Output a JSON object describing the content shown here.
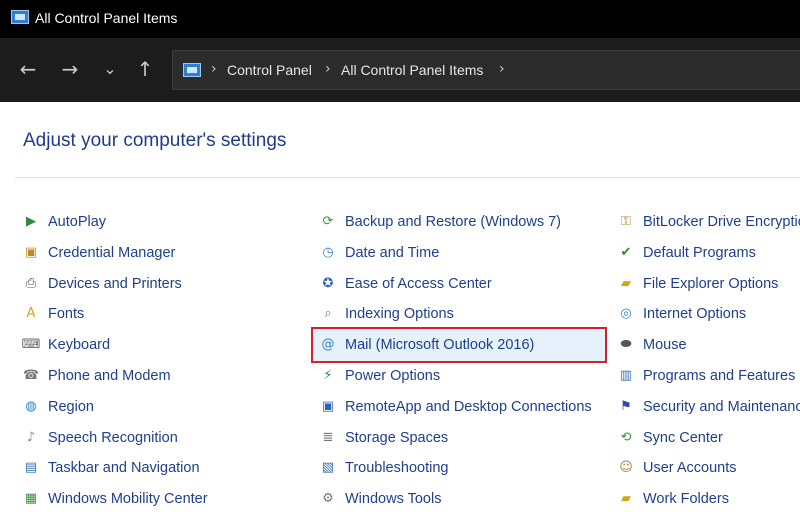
{
  "window": {
    "title": "All Control Panel Items",
    "icon": "control-panel-icon"
  },
  "nav": {
    "back": "←",
    "forward": "→",
    "recent": "⌄",
    "up": "↑"
  },
  "address": {
    "icon": "control-panel-icon",
    "separator": "›",
    "crumbs": [
      "Control Panel",
      "All Control Panel Items"
    ]
  },
  "heading": "Adjust your computer's settings",
  "columns": [
    {
      "items": [
        {
          "label": "AutoPlay",
          "icon": "autoplay-icon",
          "glyph": "▶",
          "color": "#2e8b3a"
        },
        {
          "label": "Credential Manager",
          "icon": "credential-icon",
          "glyph": "▣",
          "color": "#c08a2b"
        },
        {
          "label": "Devices and Printers",
          "icon": "printer-icon",
          "glyph": "⎙",
          "color": "#555555"
        },
        {
          "label": "Fonts",
          "icon": "fonts-icon",
          "glyph": "A",
          "color": "#d8a21c"
        },
        {
          "label": "Keyboard",
          "icon": "keyboard-icon",
          "glyph": "⌨",
          "color": "#666666"
        },
        {
          "label": "Phone and Modem",
          "icon": "phone-icon",
          "glyph": "☎",
          "color": "#777777"
        },
        {
          "label": "Region",
          "icon": "region-icon",
          "glyph": "◍",
          "color": "#2f7fc8"
        },
        {
          "label": "Speech Recognition",
          "icon": "microphone-icon",
          "glyph": "♪",
          "color": "#8a8a8a"
        },
        {
          "label": "Taskbar and Navigation",
          "icon": "taskbar-icon",
          "glyph": "▤",
          "color": "#3a6fb8"
        },
        {
          "label": "Windows Mobility Center",
          "icon": "mobility-icon",
          "glyph": "▦",
          "color": "#3c8d3c"
        }
      ]
    },
    {
      "items": [
        {
          "label": "Backup and Restore (Windows 7)",
          "icon": "backup-icon",
          "glyph": "⟳",
          "color": "#3a9a3a"
        },
        {
          "label": "Date and Time",
          "icon": "clock-icon",
          "glyph": "◷",
          "color": "#3b7cc5"
        },
        {
          "label": "Ease of Access Center",
          "icon": "accessibility-icon",
          "glyph": "✪",
          "color": "#2a64b8"
        },
        {
          "label": "Indexing Options",
          "icon": "indexing-icon",
          "glyph": "⌕",
          "color": "#777777"
        },
        {
          "label": "Mail (Microsoft Outlook 2016)",
          "icon": "mail-icon",
          "glyph": "@",
          "color": "#2f7fc8"
        },
        {
          "label": "Power Options",
          "icon": "power-icon",
          "glyph": "⚡",
          "color": "#2e8b3a"
        },
        {
          "label": "RemoteApp and Desktop Connections",
          "icon": "remoteapp-icon",
          "glyph": "▣",
          "color": "#2a64b8"
        },
        {
          "label": "Storage Spaces",
          "icon": "storage-icon",
          "glyph": "≣",
          "color": "#777777"
        },
        {
          "label": "Troubleshooting",
          "icon": "troubleshoot-icon",
          "glyph": "▧",
          "color": "#3b6fb3"
        },
        {
          "label": "Windows Tools",
          "icon": "tools-icon",
          "glyph": "⚙",
          "color": "#777777"
        }
      ]
    },
    {
      "items": [
        {
          "label": "BitLocker Drive Encryption",
          "icon": "bitlocker-icon",
          "glyph": "⚿",
          "color": "#b0862c"
        },
        {
          "label": "Default Programs",
          "icon": "default-programs-icon",
          "glyph": "✔",
          "color": "#2e8b3a"
        },
        {
          "label": "File Explorer Options",
          "icon": "folder-options-icon",
          "glyph": "▰",
          "color": "#d8a21c"
        },
        {
          "label": "Internet Options",
          "icon": "internet-icon",
          "glyph": "◎",
          "color": "#2f7fc8"
        },
        {
          "label": "Mouse",
          "icon": "mouse-icon",
          "glyph": "⬬",
          "color": "#555555"
        },
        {
          "label": "Programs and Features",
          "icon": "programs-icon",
          "glyph": "▥",
          "color": "#3b6fb3"
        },
        {
          "label": "Security and Maintenance",
          "icon": "flag-icon",
          "glyph": "⚑",
          "color": "#2a4fa8"
        },
        {
          "label": "Sync Center",
          "icon": "sync-icon",
          "glyph": "⟲",
          "color": "#2e9a3a"
        },
        {
          "label": "User Accounts",
          "icon": "user-accounts-icon",
          "glyph": "☺",
          "color": "#b8782c"
        },
        {
          "label": "Work Folders",
          "icon": "work-folders-icon",
          "glyph": "▰",
          "color": "#d8a21c"
        }
      ]
    }
  ],
  "selected": "Mail (Microsoft Outlook 2016)",
  "colors": {
    "titlebar": "#000000",
    "navbar": "#1c1c1c",
    "heading": "#1e3b8f",
    "link": "#1f3f8e",
    "highlight_border": "#d6202e",
    "highlight_fill": "#e5f1fb"
  }
}
